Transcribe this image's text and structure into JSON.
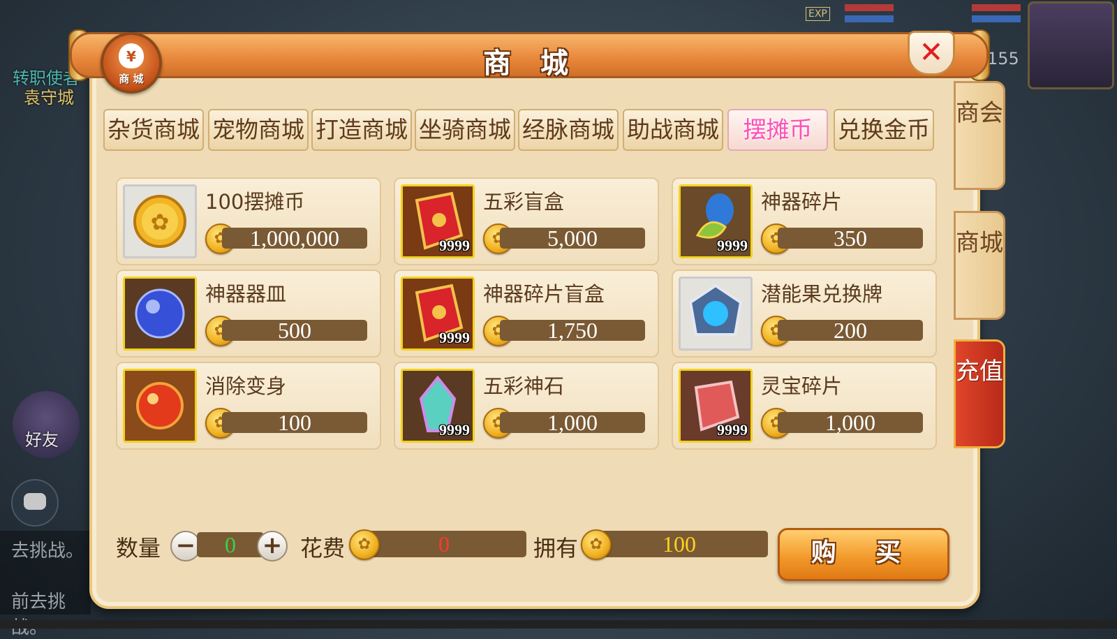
{
  "background": {
    "npc_name": "转职使者",
    "city_name": "袁守城",
    "friends_label": "好友",
    "log_lines": [
      "去挑战。",
      "前去挑战。"
    ],
    "level": "155",
    "exp_label": "EXP"
  },
  "window": {
    "title": "商 城",
    "logo_label": "商 城",
    "close_icon": "close-icon"
  },
  "tabs": [
    {
      "label": "杂货商城",
      "active": false
    },
    {
      "label": "宠物商城",
      "active": false
    },
    {
      "label": "打造商城",
      "active": false
    },
    {
      "label": "坐骑商城",
      "active": false
    },
    {
      "label": "经脉商城",
      "active": false
    },
    {
      "label": "助战商城",
      "active": false
    },
    {
      "label": "摆摊币",
      "active": true
    },
    {
      "label": "兑换金币",
      "active": false
    }
  ],
  "side_tabs": [
    {
      "label": "商会"
    },
    {
      "label": "商城"
    },
    {
      "label": "充值"
    }
  ],
  "items": [
    {
      "name": "100摆摊币",
      "price": "1,000,000",
      "qty": "",
      "icon": "gold-coin-icon",
      "frame": "silver"
    },
    {
      "name": "五彩盲盒",
      "price": "5,000",
      "qty": "9999",
      "icon": "red-scroll-box-icon",
      "frame": "gold"
    },
    {
      "name": "神器碎片",
      "price": "350",
      "qty": "9999",
      "icon": "artifact-shard-icon",
      "frame": "gold"
    },
    {
      "name": "神器器皿",
      "price": "500",
      "qty": "",
      "icon": "blue-orb-icon",
      "frame": "gold"
    },
    {
      "name": "神器碎片盲盒",
      "price": "1,750",
      "qty": "9999",
      "icon": "red-scroll-box-icon",
      "frame": "gold"
    },
    {
      "name": "潜能果兑换牌",
      "price": "200",
      "qty": "",
      "icon": "potential-token-icon",
      "frame": "silver"
    },
    {
      "name": "消除变身",
      "price": "100",
      "qty": "",
      "icon": "red-orb-icon",
      "frame": "gold"
    },
    {
      "name": "五彩神石",
      "price": "1,000",
      "qty": "9999",
      "icon": "rainbow-crystal-icon",
      "frame": "gold"
    },
    {
      "name": "灵宝碎片",
      "price": "1,000",
      "qty": "9999",
      "icon": "spirit-fragment-icon",
      "frame": "gold"
    }
  ],
  "footer": {
    "quantity_label": "数量",
    "quantity_value": "0",
    "cost_label": "花费",
    "cost_value": "0",
    "own_label": "拥有",
    "own_value": "100",
    "buy_label": "购 买"
  },
  "colors": {
    "active_tab_text": "#ff4fb6",
    "tab_text": "#5e3a1a",
    "price_bar": "#7a5a34",
    "cost_text": "#ff3a2a",
    "own_text": "#ffd21e",
    "quantity_text": "#3bd04a",
    "buy_button": "#f39a2c"
  }
}
